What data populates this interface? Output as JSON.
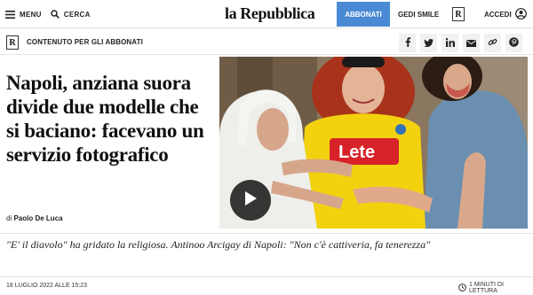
{
  "topbar": {
    "menu_label": "MENU",
    "search_label": "CERCA",
    "logo": "la Repubblica",
    "subscribe_label": "ABBONATI",
    "gedi_label": "GEDI SMILE",
    "r_mark": "R",
    "login_label": "ACCEDI"
  },
  "subbar": {
    "logo_mark": "R",
    "premium_label": "CONTENUTO PER GLI ABBONATI",
    "share_icons": [
      "facebook-icon",
      "twitter-icon",
      "linkedin-icon",
      "email-icon",
      "link-icon",
      "pinterest-icon"
    ]
  },
  "article": {
    "headline": "Napoli, anziana suora divide due modelle che si baciano: facevano un servizio fotografico",
    "author_prefix": "di",
    "author_name": "Paolo De Luca",
    "subtitle": "\"E' il diavolo\" ha gridato la religiosa. Antinoo Arcigay di Napoli: \"Non c'è cattiveria, fa tenerezza\"",
    "date": "18 LUGLIO 2022 ALLE 15:23",
    "reading_time": "1 MINUTI DI LETTURA",
    "photo_shirt_text": "Lete"
  },
  "colors": {
    "accent": "#4a8ad4",
    "shirt_yellow": "#f2d20f",
    "shirt_sponsor": "#d8222a",
    "hair_red": "#a8321a"
  }
}
